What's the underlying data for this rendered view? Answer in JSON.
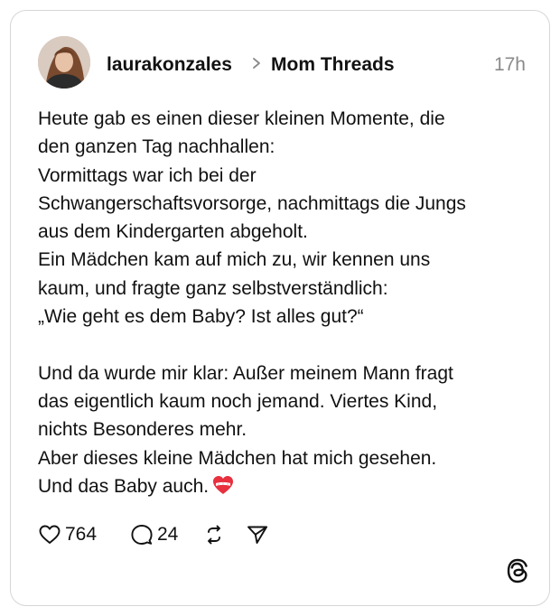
{
  "post": {
    "author": "laurakonzales",
    "community": "Mom Threads",
    "time": "17h",
    "text_lines": [
      "Heute gab es einen dieser kleinen Momente, die",
      "den ganzen Tag nachhallen:",
      "Vormittags war ich bei der",
      "Schwangerschaftsvorsorge, nachmittags die Jungs",
      "aus dem Kindergarten abgeholt.",
      "Ein Mädchen kam auf mich zu, wir kennen uns",
      "kaum, und fragte ganz selbstverständlich:",
      "„Wie geht es dem Baby? Ist alles gut?“",
      "Und da wurde mir klar: Außer meinem Mann fragt",
      "das eigentlich kaum noch jemand. Viertes Kind,",
      "nichts Besonderes mehr.",
      "Aber dieses kleine Mädchen hat mich gesehen.",
      "Und das Baby auch."
    ],
    "emoji": "mending-heart-emoji"
  },
  "actions": {
    "likes": "764",
    "replies": "24",
    "like_icon": "heart-icon",
    "reply_icon": "comment-bubble-icon",
    "repost_icon": "repost-icon",
    "share_icon": "send-icon"
  },
  "brand": {
    "logo": "threads-logo-icon"
  },
  "colors": {
    "text": "#111111",
    "muted": "#8a8a8a",
    "border": "#d6d6d6",
    "emoji_red": "#e8303f"
  }
}
